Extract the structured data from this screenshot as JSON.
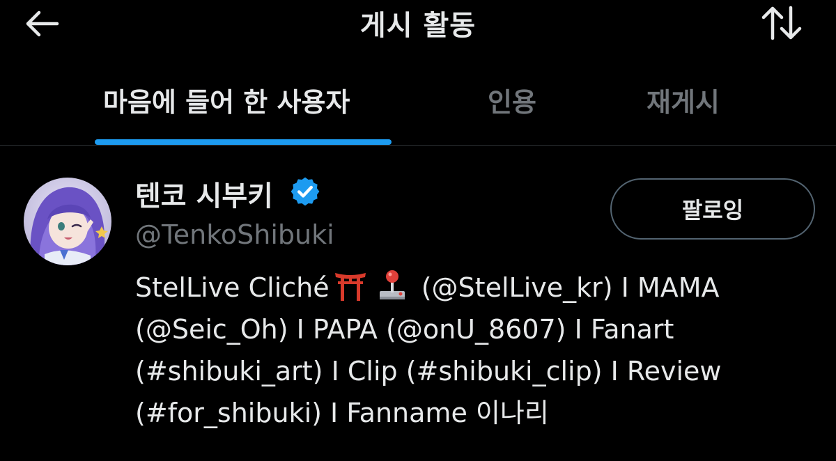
{
  "colors": {
    "background": "#000000",
    "text_primary": "#e7e9ea",
    "text_secondary": "#71767b",
    "accent": "#1d9bf0",
    "divider": "#2f3336",
    "button_border": "#536471"
  },
  "header": {
    "back_icon": "arrow-left-icon",
    "title": "게시 활동",
    "sort_icon": "sort-arrows-icon"
  },
  "tabs": [
    {
      "label": "마음에 들어 한 사용자",
      "active": true
    },
    {
      "label": "인용",
      "active": false
    },
    {
      "label": "재게시",
      "active": false
    }
  ],
  "user": {
    "display_name": "텐코 시부키",
    "verified": true,
    "verified_icon": "verified-badge-icon",
    "handle": "@TenkoShibuki",
    "follow_button": "팔로잉",
    "bio_lines": [
      {
        "before": "StelLive Cliché",
        "emojis": [
          "torii-gate-emoji",
          "joystick-emoji"
        ],
        "after": "(@StelLive_kr) I MAMA"
      },
      {
        "text": "(@Seic_Oh) I PAPA (@onU_8607) I Fanart"
      },
      {
        "text": "(#shibuki_art) I Clip (#shibuki_clip) I Review"
      },
      {
        "text": "(#for_shibuki) I Fanname 이나리"
      }
    ]
  }
}
